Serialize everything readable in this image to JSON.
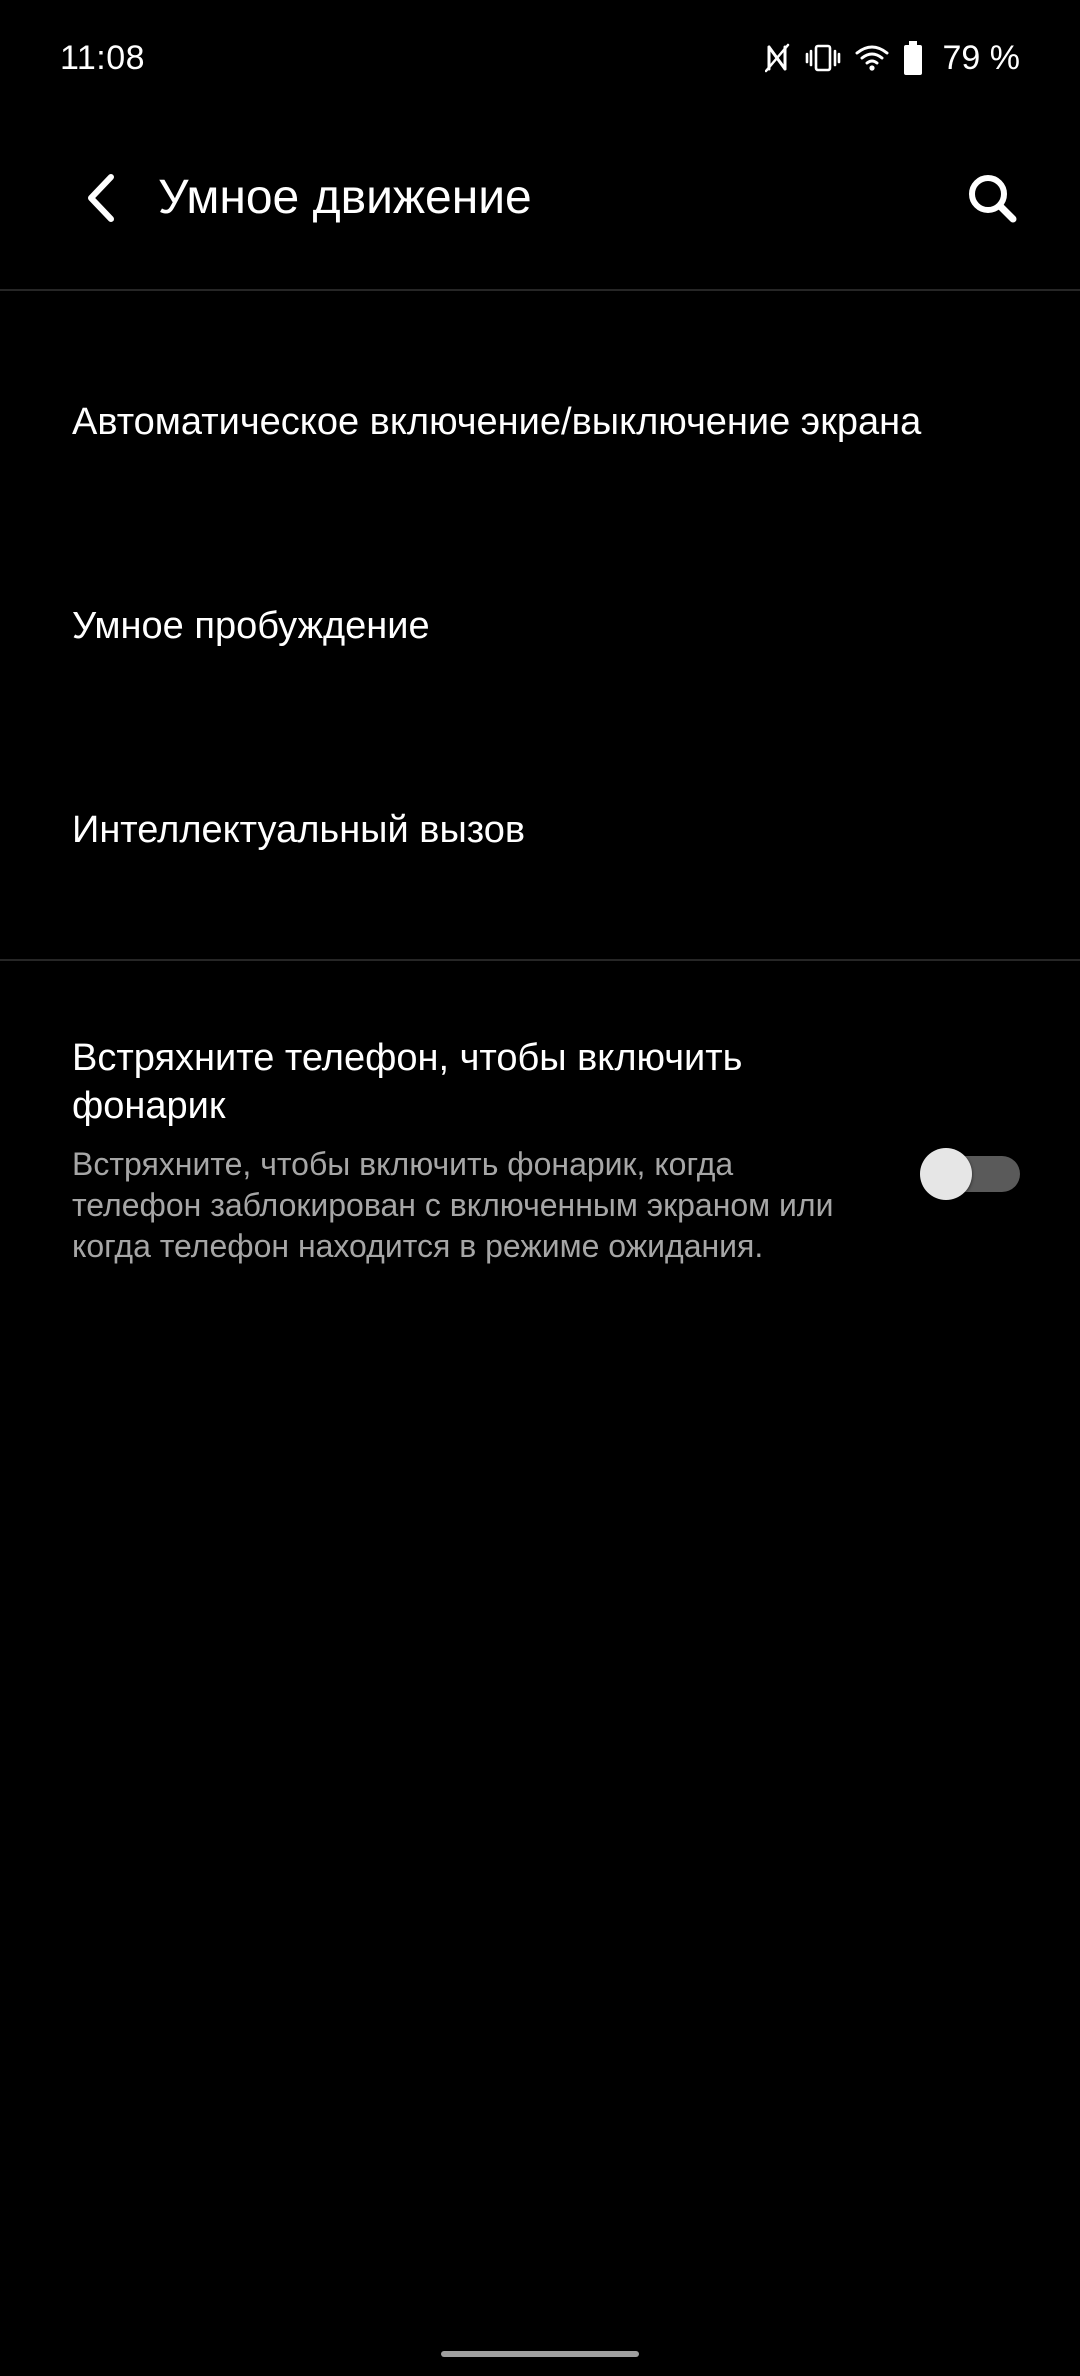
{
  "status_bar": {
    "time": "11:08",
    "icons": [
      "nfc-icon",
      "vibrate-icon",
      "wifi-icon",
      "battery-icon"
    ],
    "battery_percent": "79 %"
  },
  "app_bar": {
    "title": "Умное движение",
    "back_icon": "back-arrow-icon",
    "search_icon": "search-icon"
  },
  "menu": {
    "items": [
      {
        "label": "Автоматическое включение/выключение экрана"
      },
      {
        "label": "Умное пробуждение"
      },
      {
        "label": "Интеллектуальный вызов"
      }
    ]
  },
  "flashlight": {
    "title": "Встряхните телефон, чтобы включить фонарик",
    "description": "Встряхните, чтобы включить фонарик, когда телефон заблокирован с включенным экраном или когда телефон находится в режиме ожидания.",
    "enabled": false
  },
  "colors": {
    "background": "#000000",
    "text_primary": "#ffffff",
    "text_secondary": "#a6a6a6",
    "divider": "#262626",
    "switch_track_off": "#5a5a5a",
    "switch_thumb_off": "#e6e6e6"
  }
}
